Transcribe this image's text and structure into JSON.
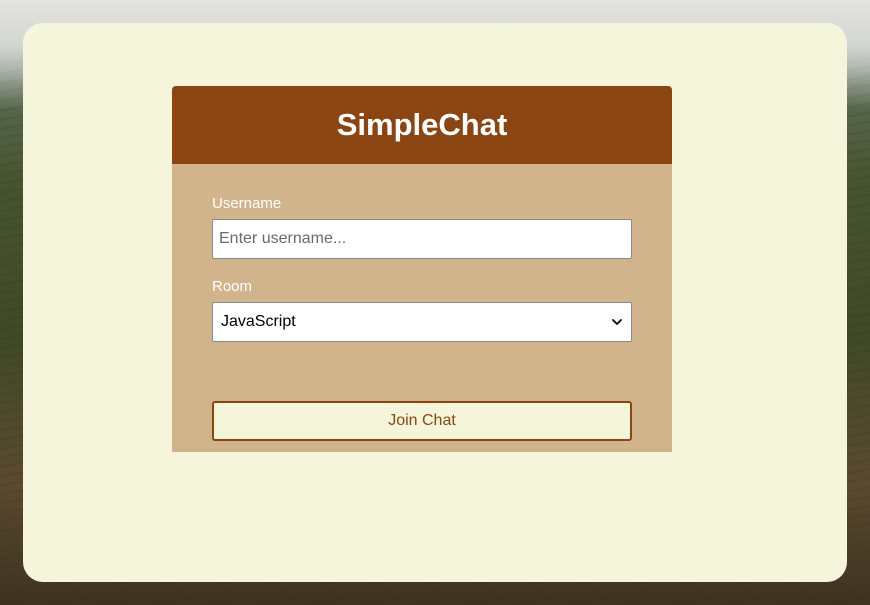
{
  "app": {
    "title": "SimpleChat"
  },
  "form": {
    "username_label": "Username",
    "username_placeholder": "Enter username...",
    "username_value": "",
    "room_label": "Room",
    "room_selected": "JavaScript",
    "join_label": "Join Chat"
  },
  "colors": {
    "header": "#8b4513",
    "card": "#d2b48c",
    "container": "#f5f5dc",
    "button_text": "#8b4513"
  },
  "icons": {
    "select_arrow": "chevron-down-icon"
  }
}
